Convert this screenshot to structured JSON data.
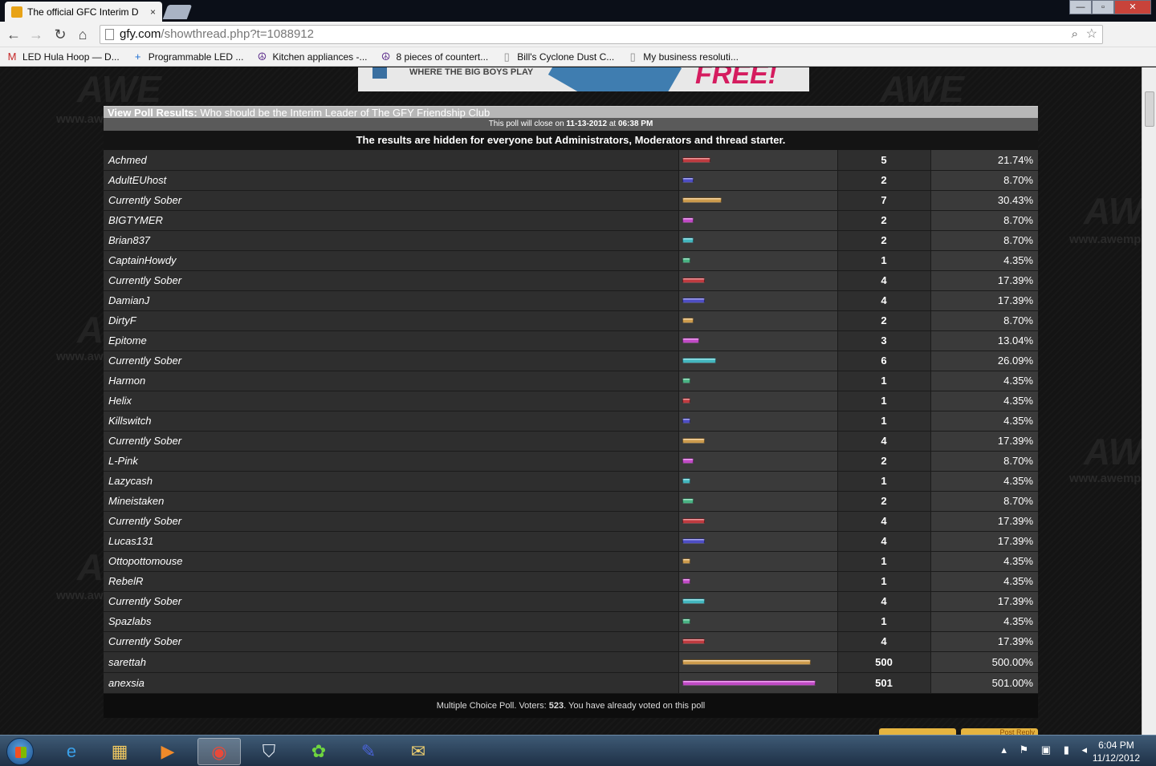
{
  "browser": {
    "tab_title": "The official GFC Interim D",
    "tab_close": "×",
    "url_host": "gfy.com",
    "url_path": "/showthread.php?t=1088912",
    "window_min": "—",
    "window_max": "▫",
    "window_close": "✕",
    "bookmarks": [
      {
        "label": "LED Hula Hoop — D...",
        "icon": "gmail-icon",
        "glyph": "M"
      },
      {
        "label": "Programmable LED ...",
        "icon": "cross-icon",
        "glyph": "+"
      },
      {
        "label": "Kitchen appliances -...",
        "icon": "peace-icon",
        "glyph": "☮"
      },
      {
        "label": "8 pieces of countert...",
        "icon": "peace-icon",
        "glyph": "☮"
      },
      {
        "label": "Bill's Cyclone Dust C...",
        "icon": "page-icon",
        "glyph": "▯"
      },
      {
        "label": "My business resoluti...",
        "icon": "page-icon",
        "glyph": "▯"
      }
    ]
  },
  "banner": {
    "slogan": "WHERE THE BIG BOYS PLAY",
    "free_text": "FREE!"
  },
  "watermark": {
    "text": "www.awemp",
    "logo": "AWE"
  },
  "poll": {
    "title_prefix": "View Poll Results:",
    "title": "Who should be the Interim Leader of The GFY Friendship Club",
    "close_prefix": "This poll will close on",
    "close_date": "11-13-2012",
    "close_mid": "at",
    "close_time": "06:38 PM",
    "hidden_note": "The results are hidden for everyone but Administrators, Moderators and thread starter.",
    "footer_prefix": "Multiple Choice Poll. Voters:",
    "voters": "523",
    "footer_suffix": ". You have already voted on this poll",
    "reply_button": "Post Reply",
    "bar_colors": [
      "#e0454b",
      "#5c5ce6",
      "#f0b65a",
      "#e257e8",
      "#4fd6df",
      "#56d19a"
    ],
    "options": [
      {
        "name": "Achmed",
        "votes": "5",
        "percent": "21.74%",
        "share": 0.2174
      },
      {
        "name": "AdultEUhost",
        "votes": "2",
        "percent": "8.70%",
        "share": 0.087
      },
      {
        "name": "Currently Sober",
        "votes": "7",
        "percent": "30.43%",
        "share": 0.3043
      },
      {
        "name": "BIGTYMER",
        "votes": "2",
        "percent": "8.70%",
        "share": 0.087
      },
      {
        "name": "Brian837",
        "votes": "2",
        "percent": "8.70%",
        "share": 0.087
      },
      {
        "name": "CaptainHowdy",
        "votes": "1",
        "percent": "4.35%",
        "share": 0.0435
      },
      {
        "name": "Currently Sober",
        "votes": "4",
        "percent": "17.39%",
        "share": 0.1739
      },
      {
        "name": "DamianJ",
        "votes": "4",
        "percent": "17.39%",
        "share": 0.1739
      },
      {
        "name": "DirtyF",
        "votes": "2",
        "percent": "8.70%",
        "share": 0.087
      },
      {
        "name": "Epitome",
        "votes": "3",
        "percent": "13.04%",
        "share": 0.1304
      },
      {
        "name": "Currently Sober",
        "votes": "6",
        "percent": "26.09%",
        "share": 0.2609
      },
      {
        "name": "Harmon",
        "votes": "1",
        "percent": "4.35%",
        "share": 0.0435
      },
      {
        "name": "Helix",
        "votes": "1",
        "percent": "4.35%",
        "share": 0.0435
      },
      {
        "name": "Killswitch",
        "votes": "1",
        "percent": "4.35%",
        "share": 0.0435
      },
      {
        "name": "Currently Sober",
        "votes": "4",
        "percent": "17.39%",
        "share": 0.1739
      },
      {
        "name": "L-Pink",
        "votes": "2",
        "percent": "8.70%",
        "share": 0.087
      },
      {
        "name": "Lazycash",
        "votes": "1",
        "percent": "4.35%",
        "share": 0.0435
      },
      {
        "name": "Mineistaken",
        "votes": "2",
        "percent": "8.70%",
        "share": 0.087
      },
      {
        "name": "Currently Sober",
        "votes": "4",
        "percent": "17.39%",
        "share": 0.1739
      },
      {
        "name": "Lucas131",
        "votes": "4",
        "percent": "17.39%",
        "share": 0.1739
      },
      {
        "name": "Ottopottomouse",
        "votes": "1",
        "percent": "4.35%",
        "share": 0.0435
      },
      {
        "name": "RebelR",
        "votes": "1",
        "percent": "4.35%",
        "share": 0.0435
      },
      {
        "name": "Currently Sober",
        "votes": "4",
        "percent": "17.39%",
        "share": 0.1739
      },
      {
        "name": "Spazlabs",
        "votes": "1",
        "percent": "4.35%",
        "share": 0.0435
      },
      {
        "name": "Currently Sober",
        "votes": "4",
        "percent": "17.39%",
        "share": 0.1739
      },
      {
        "name": "sarettah",
        "votes": "500",
        "percent": "500.00%",
        "share": 1.0
      },
      {
        "name": "anexsia",
        "votes": "501",
        "percent": "501.00%",
        "share": 1.04
      }
    ]
  },
  "taskbar": {
    "apps": [
      {
        "name": "ie-icon",
        "glyph": "e",
        "color": "#3aa0e8"
      },
      {
        "name": "explorer-icon",
        "glyph": "▦",
        "color": "#f0c860"
      },
      {
        "name": "media-player-icon",
        "glyph": "▶",
        "color": "#f08a2a"
      },
      {
        "name": "chrome-icon",
        "glyph": "◉",
        "color": "#e84a3a"
      },
      {
        "name": "shield-icon",
        "glyph": "⛉",
        "color": "#dfe6ee"
      },
      {
        "name": "icq-icon",
        "glyph": "✿",
        "color": "#6fd63f"
      },
      {
        "name": "pen-icon",
        "glyph": "✎",
        "color": "#4a64d8"
      },
      {
        "name": "mail-icon",
        "glyph": "✉",
        "color": "#f0d070"
      }
    ],
    "tray_glyphs": "▴ ⚑ ▣ ▮ ◂",
    "time": "6:04 PM",
    "date": "11/12/2012"
  }
}
